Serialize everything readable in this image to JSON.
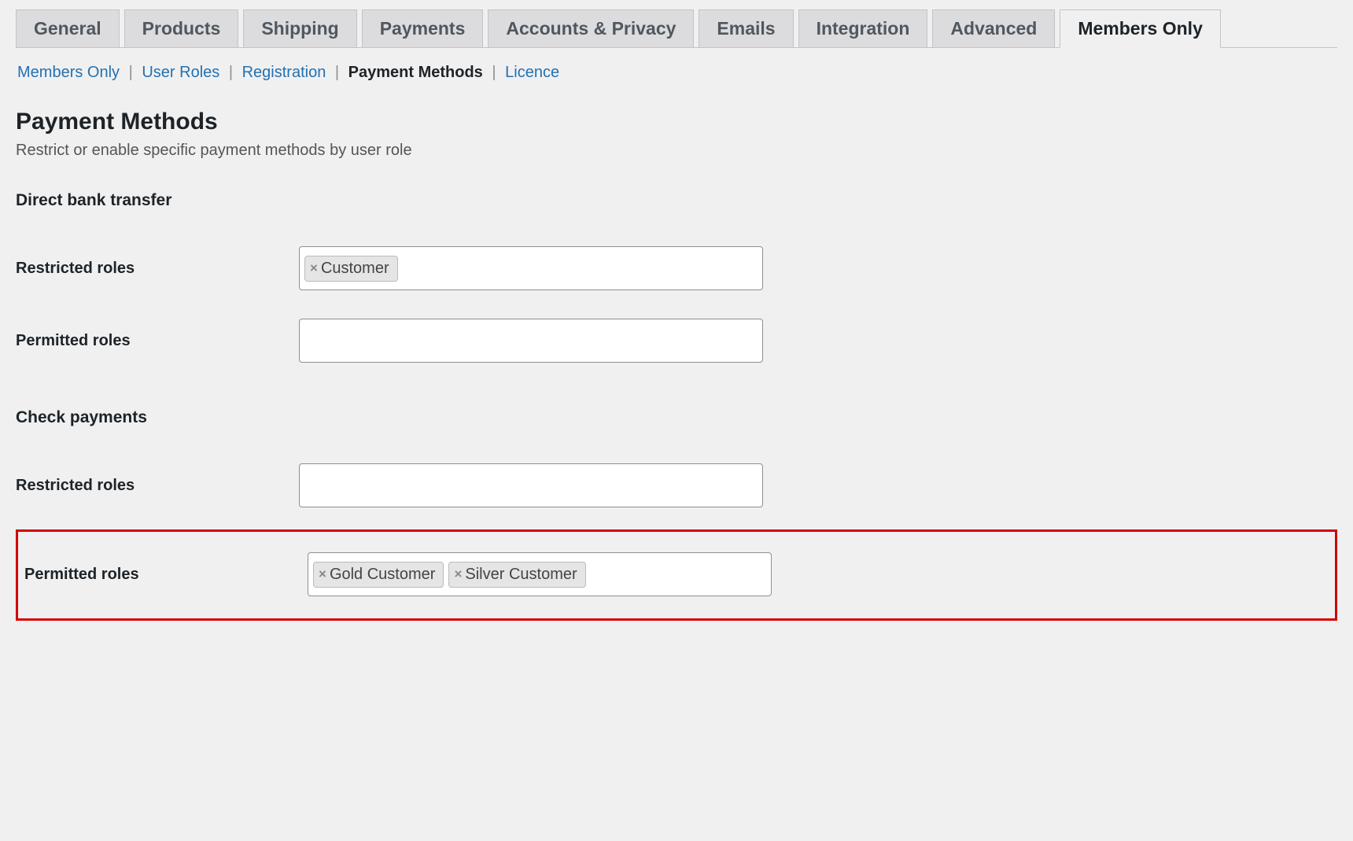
{
  "tabs": {
    "items": [
      {
        "label": "General"
      },
      {
        "label": "Products"
      },
      {
        "label": "Shipping"
      },
      {
        "label": "Payments"
      },
      {
        "label": "Accounts & Privacy"
      },
      {
        "label": "Emails"
      },
      {
        "label": "Integration"
      },
      {
        "label": "Advanced"
      },
      {
        "label": "Members Only",
        "active": true
      }
    ]
  },
  "subsub": {
    "members_only": "Members Only",
    "user_roles": "User Roles",
    "registration": "Registration",
    "payment_methods": "Payment Methods",
    "licence": "Licence"
  },
  "section": {
    "title": "Payment Methods",
    "desc": "Restrict or enable specific payment methods by user role"
  },
  "gateways": {
    "bacs": {
      "heading": "Direct bank transfer",
      "restricted_label": "Restricted roles",
      "permitted_label": "Permitted roles",
      "restricted_tags": [
        "Customer"
      ],
      "permitted_tags": []
    },
    "cheque": {
      "heading": "Check payments",
      "restricted_label": "Restricted roles",
      "permitted_label": "Permitted roles",
      "restricted_tags": [],
      "permitted_tags": [
        "Gold Customer",
        "Silver Customer"
      ]
    }
  }
}
